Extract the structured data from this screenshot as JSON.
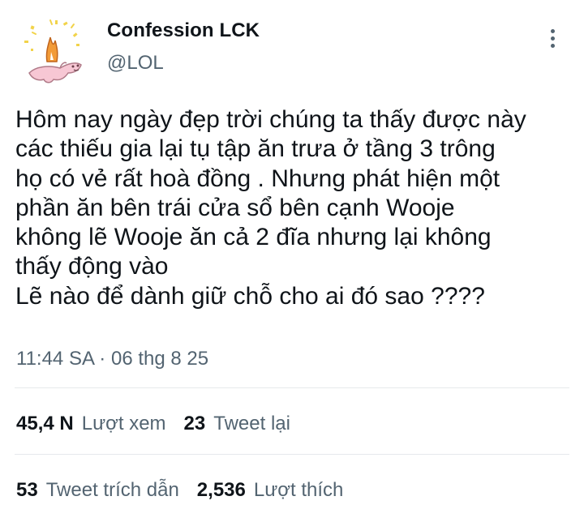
{
  "author": {
    "display_name": "Confession LCK",
    "handle": "@LOL"
  },
  "tweet": {
    "text_lines": [
      "Hôm nay ngày đẹp trời chúng ta thấy được này",
      "các thiếu gia lại tụ tập ăn trưa ở tầng 3 trông",
      "họ có vẻ rất hoà đồng . Nhưng phát hiện một",
      "phần ăn bên trái cửa sổ bên cạnh Wooje",
      "không lẽ Wooje ăn cả 2 đĩa nhưng lại không",
      "thấy động vào",
      "Lẽ nào để dành giữ chỗ cho ai đó sao ????"
    ],
    "timestamp": "11:44 SA · 06 thg 8 25"
  },
  "stats": {
    "views_count": "45,4 N",
    "views_label": "Lượt xem",
    "retweets_count": "23",
    "retweets_label": "Tweet lại",
    "quotes_count": "53",
    "quotes_label": "Tweet trích dẫn",
    "likes_count": "2,536",
    "likes_label": "Lượt thích"
  },
  "icons": {
    "more": "more-vertical-icon"
  },
  "colors": {
    "text_primary": "#0f1419",
    "text_secondary": "#536471",
    "divider": "#e6e9ec",
    "avatar_accent": "#f2c94c"
  }
}
